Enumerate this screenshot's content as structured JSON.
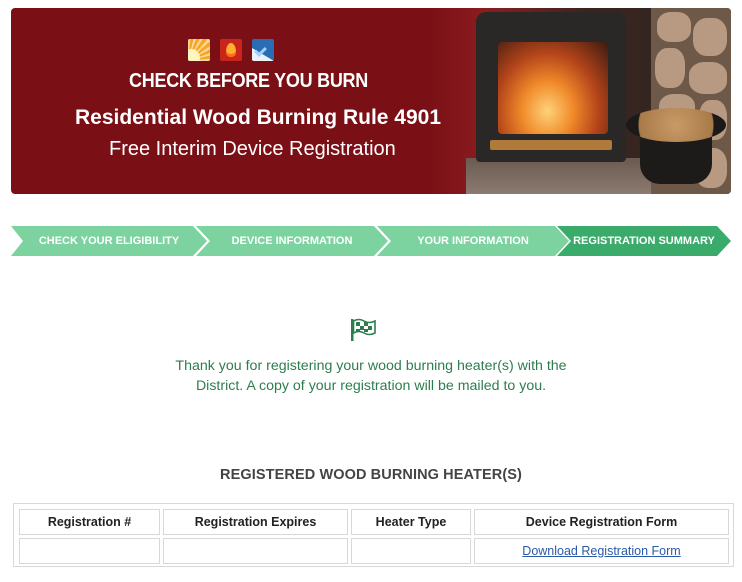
{
  "banner": {
    "program_title": "CHECK BEFORE YOU BURN",
    "rule_title": "Residential Wood Burning Rule 4901",
    "subtitle": "Free Interim Device Registration"
  },
  "steps": [
    {
      "label": "CHECK YOUR ELIGIBILITY",
      "state": "complete"
    },
    {
      "label": "DEVICE INFORMATION",
      "state": "complete"
    },
    {
      "label": "YOUR INFORMATION",
      "state": "complete"
    },
    {
      "label": "REGISTRATION SUMMARY",
      "state": "active"
    }
  ],
  "colors": {
    "banner_red": "#7a1015",
    "step_light": "#7dd3a0",
    "step_active": "#3aab6a",
    "message_green": "#2e7d4f",
    "link_blue": "#2a5aa8"
  },
  "confirmation": {
    "icon": "checkered-flag-icon",
    "message": "Thank you for registering your wood burning heater(s) with the District. A copy of your registration will be mailed to you."
  },
  "registered": {
    "title": "REGISTERED WOOD BURNING HEATER(S)",
    "columns": [
      "Registration #",
      "Registration Expires",
      "Heater Type",
      "Device Registration Form"
    ],
    "rows": [
      {
        "registration_no": "",
        "expires": "",
        "heater_type": "",
        "form_link": "Download Registration Form"
      }
    ]
  }
}
